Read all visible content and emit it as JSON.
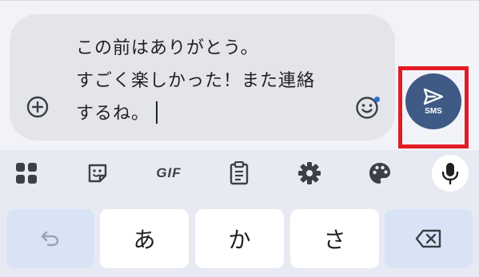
{
  "compose": {
    "message_lines": "この前はありがとう。\nすごく楽しかった！また連絡\nするね。",
    "add_icon": "add-circle-icon",
    "emoji_icon": "emoji-icon",
    "send": {
      "label": "SMS",
      "icon": "send-icon",
      "highlight_color": "#e31b23",
      "button_color": "#3f5a84"
    }
  },
  "keyboard": {
    "toolbar": [
      {
        "name": "apps",
        "icon": "apps-grid-icon"
      },
      {
        "name": "sticker",
        "icon": "sticker-icon"
      },
      {
        "name": "gif",
        "label": "GIF"
      },
      {
        "name": "clipboard",
        "icon": "clipboard-icon"
      },
      {
        "name": "settings",
        "icon": "gear-icon"
      },
      {
        "name": "theme",
        "icon": "palette-icon"
      },
      {
        "name": "voice",
        "icon": "mic-icon"
      }
    ],
    "keys": {
      "undo": "undo-icon",
      "key1": "あ",
      "key2": "か",
      "key3": "さ",
      "backspace": "backspace-icon"
    }
  }
}
